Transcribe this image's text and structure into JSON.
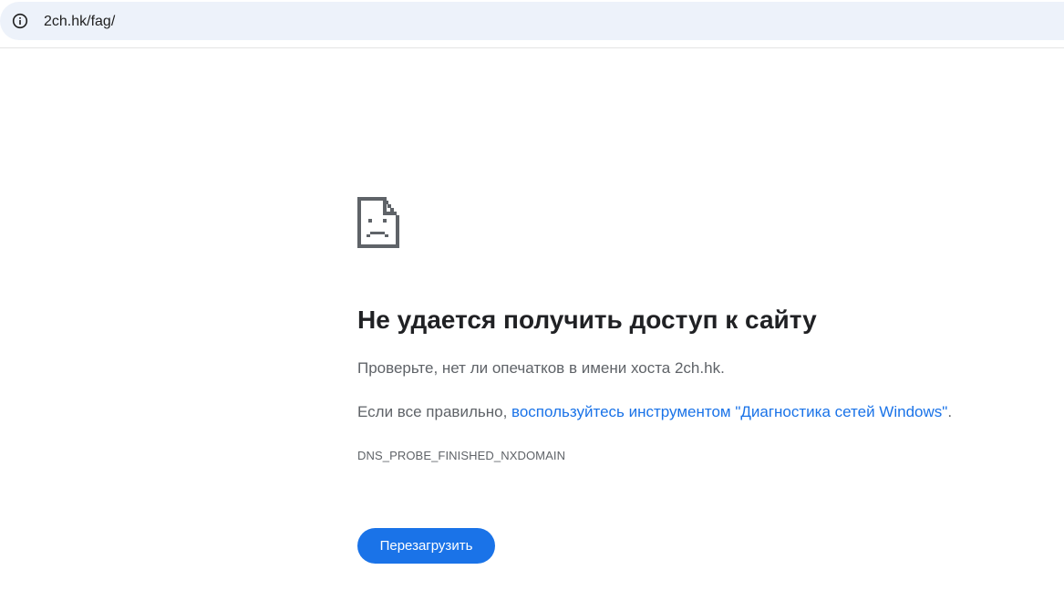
{
  "browser": {
    "url": "2ch.hk/fag/",
    "info_icon": "info-icon"
  },
  "error_page": {
    "icon": "sad-page-icon",
    "title": "Не удается получить доступ к сайту",
    "check_text": "Проверьте, нет ли опечатков в имени хоста 2ch.hk.",
    "if_correct_prefix": "Если все правильно, ",
    "diagnostics_link": "воспользуйтесь инструментом \"Диагностика сетей Windows\"",
    "if_correct_suffix": ".",
    "error_code": "DNS_PROBE_FINISHED_NXDOMAIN",
    "reload_label": "Перезагрузить"
  },
  "colors": {
    "accent": "#1a73e8",
    "address_bar_bg": "#edf2fa",
    "title_text": "#202124",
    "body_text": "#5f6368"
  }
}
